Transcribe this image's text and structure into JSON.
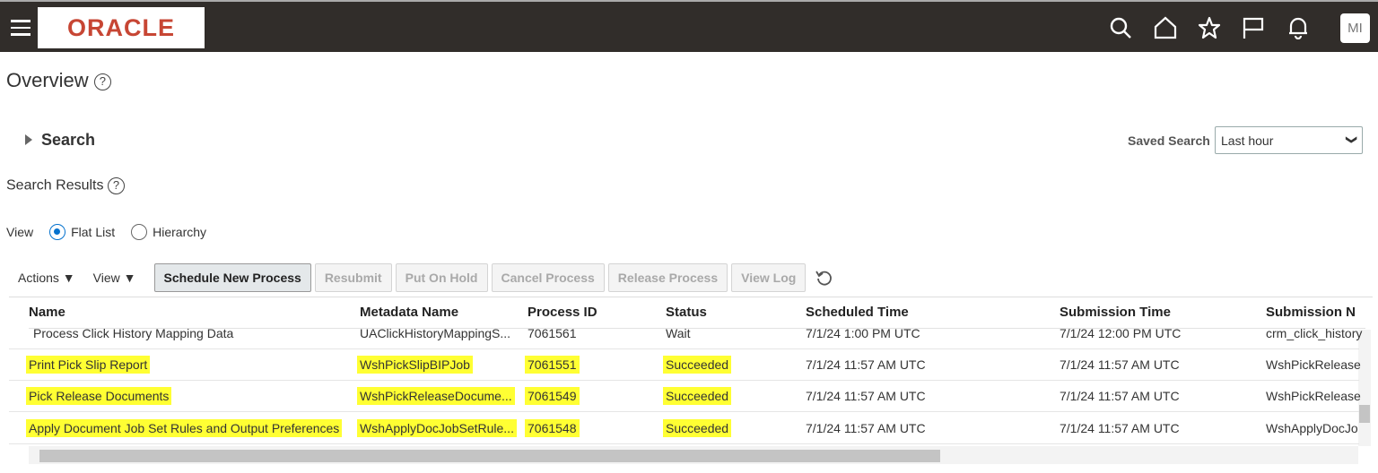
{
  "header": {
    "logo": "ORACLE",
    "avatar": "MI",
    "icons": [
      "menu-icon",
      "search-icon",
      "home-icon",
      "star-icon",
      "flag-icon",
      "bell-icon"
    ]
  },
  "page": {
    "title": "Overview"
  },
  "search": {
    "label": "Search",
    "saved_search_label": "Saved Search",
    "saved_search_value": "Last hour"
  },
  "results": {
    "label": "Search Results",
    "view_label": "View",
    "view_options": [
      "Flat List",
      "Hierarchy"
    ],
    "view_selected": "Flat List"
  },
  "toolbar": {
    "actions": "Actions",
    "view": "View",
    "buttons": [
      "Schedule New Process",
      "Resubmit",
      "Put On Hold",
      "Cancel Process",
      "Release Process",
      "View Log"
    ]
  },
  "table": {
    "columns": [
      "Name",
      "Metadata Name",
      "Process ID",
      "Status",
      "Scheduled Time",
      "Submission Time",
      "Submission N"
    ],
    "rows": [
      {
        "name": "Process Click History Mapping Data",
        "meta": "UAClickHistoryMappingS...",
        "pid": "7061561",
        "status": "Wait",
        "sched": "7/1/24 1:00 PM UTC",
        "sub": "7/1/24 12:00 PM UTC",
        "subn": "crm_click_history",
        "highlight": false
      },
      {
        "name": "Print Pick Slip Report",
        "meta": "WshPickSlipBIPJob",
        "pid": "7061551",
        "status": "Succeeded",
        "sched": "7/1/24 11:57 AM UTC",
        "sub": "7/1/24 11:57 AM UTC",
        "subn": "WshPickRelease",
        "highlight": true
      },
      {
        "name": "Pick Release Documents",
        "meta": "WshPickReleaseDocume...",
        "pid": "7061549",
        "status": "Succeeded",
        "sched": "7/1/24 11:57 AM UTC",
        "sub": "7/1/24 11:57 AM UTC",
        "subn": "WshPickRelease",
        "highlight": true
      },
      {
        "name": "Apply Document Job Set Rules and Output Preferences",
        "meta": "WshApplyDocJobSetRule...",
        "pid": "7061548",
        "status": "Succeeded",
        "sched": "7/1/24 11:57 AM UTC",
        "sub": "7/1/24 11:57 AM UTC",
        "subn": "WshApplyDocJo",
        "highlight": true
      }
    ],
    "highlight_color": "#ffff33"
  }
}
